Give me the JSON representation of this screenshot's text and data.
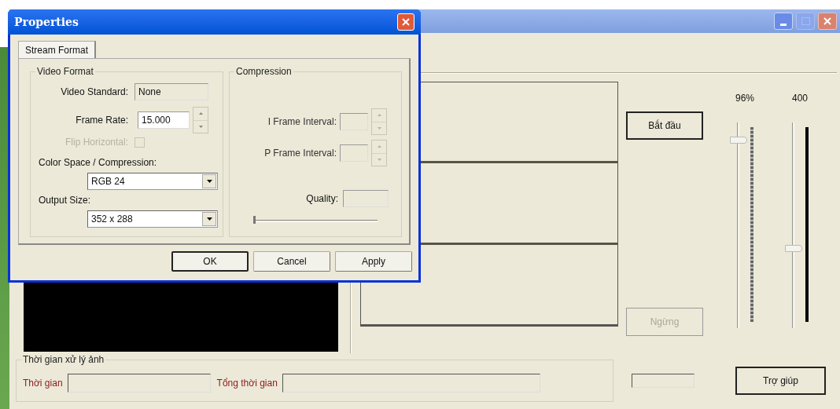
{
  "main_window": {
    "buttons": [
      {
        "label": "Bắt đầu",
        "disabled": false
      },
      {
        "label": "Ngừng",
        "disabled": true
      }
    ],
    "sliders": [
      {
        "reading": "96%",
        "level": 0.93
      },
      {
        "reading": "400",
        "level": 0.38
      }
    ],
    "timing_group": {
      "title": "Thời gian xử lý ảnh",
      "fields": [
        {
          "label": "Thời gian"
        },
        {
          "label": "Tổng thời gian"
        }
      ]
    },
    "help_button": "Trợ giúp"
  },
  "dialog": {
    "title": "Properties",
    "tabs": [
      {
        "label": "Stream Format",
        "selected": true
      }
    ],
    "video_format": {
      "title": "Video Format",
      "video_standard": {
        "label": "Video Standard:",
        "value": "None"
      },
      "frame_rate": {
        "label": "Frame Rate:",
        "value": "15.000"
      },
      "flip_horizontal": {
        "label": "Flip Horizontal:",
        "checked": false,
        "disabled": true
      },
      "color_space": {
        "label": "Color Space / Compression:",
        "value": "RGB 24"
      },
      "output_size": {
        "label": "Output Size:",
        "value": "352 x 288"
      }
    },
    "compression": {
      "title": "Compression",
      "i_frame": {
        "label": "I Frame Interval:",
        "disabled": true
      },
      "p_frame": {
        "label": "P Frame Interval:",
        "disabled": true
      },
      "quality": {
        "label": "Quality:",
        "level": 0
      }
    },
    "buttons": [
      {
        "label": "OK",
        "default": true
      },
      {
        "label": "Cancel",
        "default": false
      },
      {
        "label": "Apply",
        "default": false
      }
    ]
  }
}
